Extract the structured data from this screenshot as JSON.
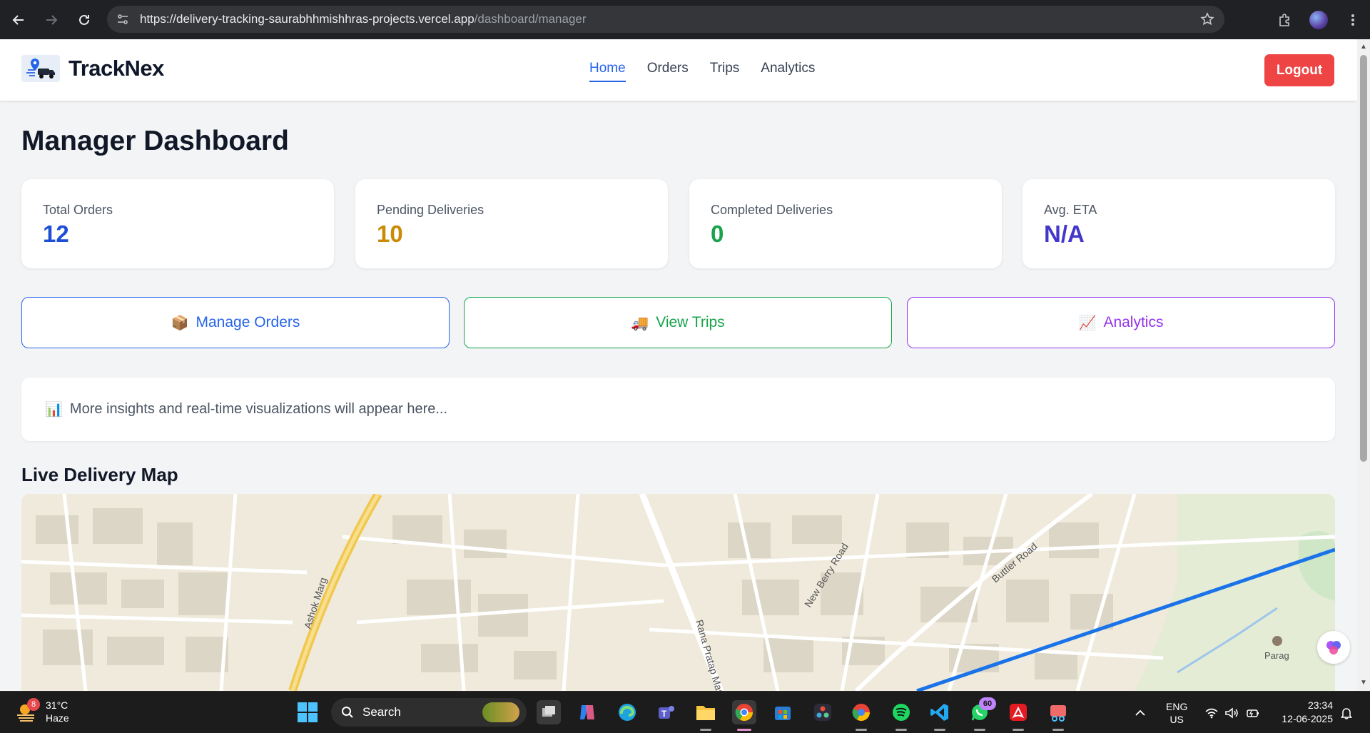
{
  "browser": {
    "url_host": "https://delivery-tracking-saurabhhmishhras-projects.vercel.app",
    "url_path": "/dashboard/manager"
  },
  "header": {
    "brand": "TrackNex",
    "nav": [
      {
        "label": "Home",
        "active": true
      },
      {
        "label": "Orders",
        "active": false
      },
      {
        "label": "Trips",
        "active": false
      },
      {
        "label": "Analytics",
        "active": false
      }
    ],
    "logout_label": "Logout"
  },
  "page": {
    "title": "Manager Dashboard"
  },
  "stats": [
    {
      "label": "Total Orders",
      "value": "12",
      "color": "#1d4ed8"
    },
    {
      "label": "Pending Deliveries",
      "value": "10",
      "color": "#ca8a04"
    },
    {
      "label": "Completed Deliveries",
      "value": "0",
      "color": "#16a34a"
    },
    {
      "label": "Avg. ETA",
      "value": "N/A",
      "color": "#4338ca"
    }
  ],
  "actions": [
    {
      "emoji": "📦",
      "label": "Manage Orders",
      "color": "#2563eb"
    },
    {
      "emoji": "🚚",
      "label": "View Trips",
      "color": "#16a34a"
    },
    {
      "emoji": "📈",
      "label": "Analytics",
      "color": "#9333ea"
    }
  ],
  "insights": {
    "emoji": "📊",
    "text": "More insights and real-time visualizations will appear here..."
  },
  "map": {
    "title": "Live Delivery Map",
    "labels": [
      "Ashok Marg",
      "Rana Pratap Marg",
      "New Berry Road",
      "Buttler Road",
      "Parag"
    ]
  },
  "taskbar": {
    "weather_temp": "31°C",
    "weather_desc": "Haze",
    "weather_badge": "8",
    "search_label": "Search",
    "whatsapp_badge": "60",
    "lang_primary": "ENG",
    "lang_secondary": "US",
    "time": "23:34",
    "date": "12-06-2025"
  }
}
